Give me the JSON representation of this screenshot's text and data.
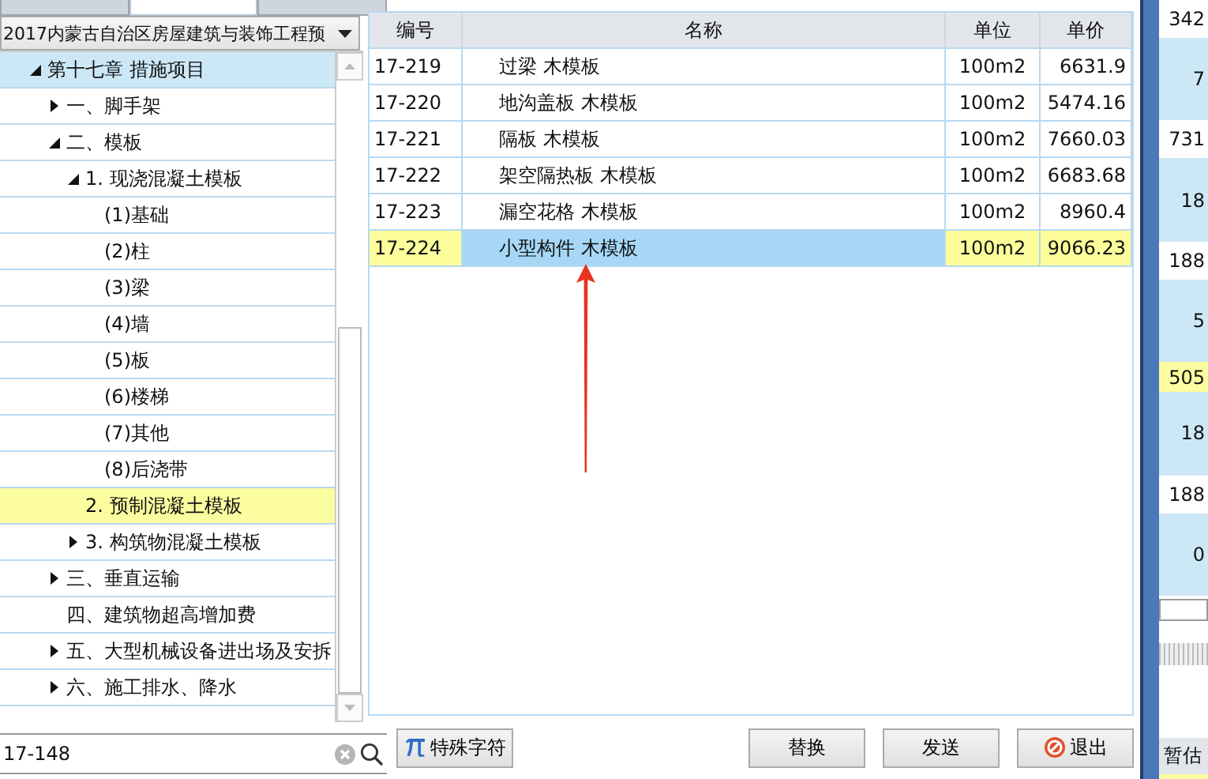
{
  "tabs": [
    {
      "selected": false
    },
    {
      "selected": true
    },
    {
      "selected": false
    }
  ],
  "library_dropdown": {
    "value": "2017内蒙古自治区房屋建筑与装饰工程预"
  },
  "tree": [
    {
      "label": "第十七章 措施项目",
      "expanded": true,
      "selected": false,
      "focused": true,
      "children": [
        {
          "label": "一、脚手架",
          "expanded": false,
          "selected": false,
          "focused": false
        },
        {
          "label": "二、模板",
          "expanded": true,
          "selected": false,
          "focused": false,
          "children": [
            {
              "label": "1. 现浇混凝土模板",
              "expanded": true,
              "selected": false,
              "focused": false,
              "children": [
                {
                  "label": "(1)基础",
                  "selected": false,
                  "focused": false
                },
                {
                  "label": "(2)柱",
                  "selected": false,
                  "focused": false
                },
                {
                  "label": "(3)梁",
                  "selected": false,
                  "focused": false
                },
                {
                  "label": "(4)墙",
                  "selected": false,
                  "focused": false
                },
                {
                  "label": "(5)板",
                  "selected": false,
                  "focused": false
                },
                {
                  "label": "(6)楼梯",
                  "selected": false,
                  "focused": false
                },
                {
                  "label": "(7)其他",
                  "selected": false,
                  "focused": false
                },
                {
                  "label": "(8)后浇带",
                  "selected": false,
                  "focused": false
                }
              ]
            },
            {
              "label": "2. 预制混凝土模板",
              "selected": true,
              "focused": false
            },
            {
              "label": "3. 构筑物混凝土模板",
              "expanded": false,
              "selected": false,
              "focused": false
            }
          ]
        },
        {
          "label": "三、垂直运输",
          "expanded": false,
          "selected": false,
          "focused": false
        },
        {
          "label": "四、建筑物超高增加费",
          "selected": false,
          "focused": false
        },
        {
          "label": "五、大型机械设备进出场及安拆",
          "expanded": false,
          "selected": false,
          "focused": false
        },
        {
          "label": "六、施工排水、降水",
          "expanded": false,
          "selected": false,
          "focused": false
        }
      ]
    }
  ],
  "search": {
    "value": "17-148"
  },
  "table": {
    "columns": [
      "编号",
      "名称",
      "单位",
      "单价"
    ],
    "rows": [
      {
        "code": "17-219",
        "name": "过梁 木模板",
        "unit": "100m2",
        "price": "6631.9",
        "selected": false
      },
      {
        "code": "17-220",
        "name": "地沟盖板 木模板",
        "unit": "100m2",
        "price": "5474.16",
        "selected": false
      },
      {
        "code": "17-221",
        "name": "隔板 木模板",
        "unit": "100m2",
        "price": "7660.03",
        "selected": false
      },
      {
        "code": "17-222",
        "name": "架空隔热板 木模板",
        "unit": "100m2",
        "price": "6683.68",
        "selected": false
      },
      {
        "code": "17-223",
        "name": "漏空花格 木模板",
        "unit": "100m2",
        "price": "8960.4",
        "selected": false
      },
      {
        "code": "17-224",
        "name": "小型构件 木模板",
        "unit": "100m2",
        "price": "9066.23",
        "selected": true
      }
    ]
  },
  "buttons": [
    {
      "label": "特殊字符",
      "kind": "pi"
    },
    {
      "label": "替换",
      "kind": "plain"
    },
    {
      "label": "发送",
      "kind": "plain"
    },
    {
      "label": "退出",
      "kind": "exit"
    }
  ],
  "side_cells": [
    {
      "text": "342",
      "kind": "plain"
    },
    {
      "text": "7",
      "kind": "group"
    },
    {
      "text": "731",
      "kind": "plain"
    },
    {
      "text": "18",
      "kind": "group"
    },
    {
      "text": "188",
      "kind": "plain"
    },
    {
      "text": "5",
      "kind": "group"
    },
    {
      "text": "505",
      "kind": "highlight"
    },
    {
      "text": "18",
      "kind": "group"
    },
    {
      "text": "188",
      "kind": "plain"
    },
    {
      "text": "0",
      "kind": "group"
    }
  ],
  "side_header": "暂估"
}
